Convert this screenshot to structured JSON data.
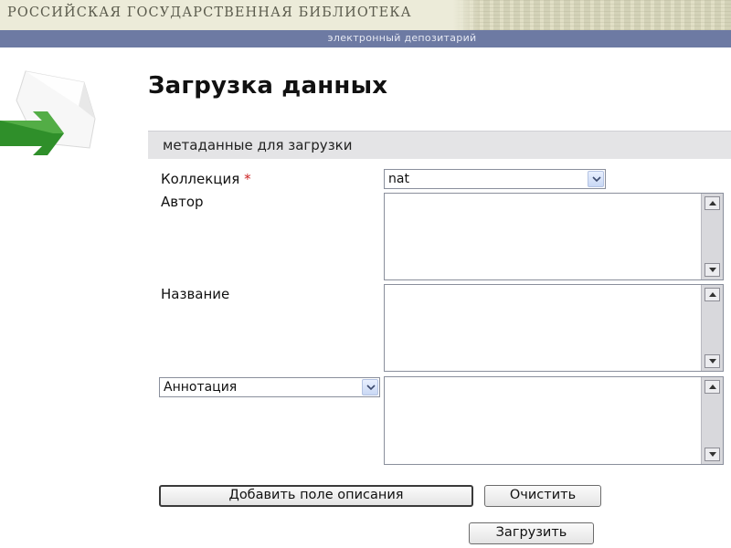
{
  "header": {
    "library_name": "РОССИЙСКАЯ ГОСУДАРСТВЕННАЯ БИБЛИОТЕКА",
    "subtitle": "электронный депозитарий"
  },
  "page": {
    "title": "Загрузка данных",
    "graphic_icon": "green-arrow-document-icon"
  },
  "form": {
    "section_title": "метаданные для загрузки",
    "collection": {
      "label": "Коллекция",
      "required_mark": "*",
      "value": "nat"
    },
    "author": {
      "label": "Автор",
      "value": ""
    },
    "title_field": {
      "label": "Название",
      "value": ""
    },
    "annotation": {
      "selected_type": "Аннотация",
      "value": ""
    },
    "buttons": {
      "add_field": "Добавить поле описания",
      "clear": "Очистить",
      "upload": "Загрузить"
    }
  },
  "colors": {
    "banner_bg": "#ecebd9",
    "subbar_bg": "#6d7aa3",
    "panel_header_bg": "#e4e4e6",
    "required": "#cc2222",
    "arrow_green": "#2f8f2a"
  }
}
